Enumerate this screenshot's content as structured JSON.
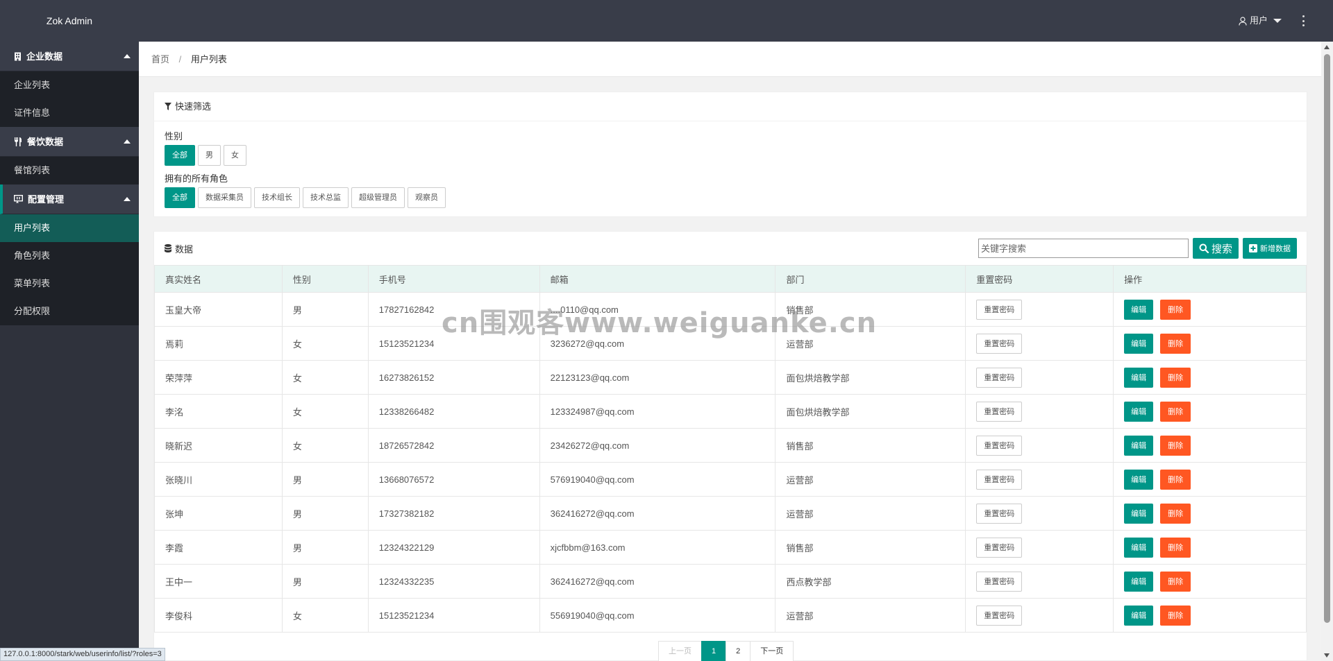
{
  "app": {
    "title": "Zok Admin"
  },
  "header": {
    "user_label": "用户"
  },
  "sidebar": {
    "groups": [
      {
        "title": "企业数据",
        "icon": "building-icon",
        "items": [
          "企业列表",
          "证件信息"
        ]
      },
      {
        "title": "餐饮数据",
        "icon": "utensils-icon",
        "items": [
          "餐馆列表"
        ]
      },
      {
        "title": "配置管理",
        "icon": "monitor-icon",
        "items": [
          "用户列表",
          "角色列表",
          "菜单列表",
          "分配权限"
        ]
      }
    ],
    "active_item": "用户列表"
  },
  "breadcrumb": {
    "home": "首页",
    "separator": "/",
    "current": "用户列表"
  },
  "filter": {
    "title": "快速筛选",
    "gender_label": "性别",
    "gender_options": [
      "全部",
      "男",
      "女"
    ],
    "gender_selected": "全部",
    "roles_label": "拥有的所有角色",
    "role_options": [
      "全部",
      "数据采集员",
      "技术组长",
      "技术总监",
      "超级管理员",
      "观察员"
    ],
    "role_selected": "全部"
  },
  "data_panel": {
    "title": "数据",
    "search_placeholder": "关键字搜索",
    "search_button": "搜索",
    "add_button": "新增数据"
  },
  "table": {
    "columns": [
      "真实姓名",
      "性别",
      "手机号",
      "邮箱",
      "部门",
      "重置密码",
      "操作"
    ],
    "reset_label": "重置密码",
    "edit_label": "编辑",
    "delete_label": "删除",
    "rows": [
      [
        "玉皇大帝",
        "男",
        "17827162842",
        "....0110@qq.com",
        "销售部"
      ],
      [
        "焉莉",
        "女",
        "15123521234",
        "3236272@qq.com",
        "运营部"
      ],
      [
        "荣萍萍",
        "女",
        "16273826152",
        "22123123@qq.com",
        "面包烘焙教学部"
      ],
      [
        "李洺",
        "女",
        "12338266482",
        "123324987@qq.com",
        "面包烘焙教学部"
      ],
      [
        "晓新迟",
        "女",
        "18726572842",
        "23426272@qq.com",
        "销售部"
      ],
      [
        "张晓川",
        "男",
        "13668076572",
        "576919040@qq.com",
        "运营部"
      ],
      [
        "张坤",
        "男",
        "17327382182",
        "362416272@qq.com",
        "运营部"
      ],
      [
        "李霞",
        "男",
        "12324322129",
        "xjcfbbm@163.com",
        "销售部"
      ],
      [
        "王中一",
        "男",
        "12324332235",
        "362416272@qq.com",
        "西点教学部"
      ],
      [
        "李俊科",
        "女",
        "15123521234",
        "556919040@qq.com",
        "运营部"
      ]
    ]
  },
  "pagination": {
    "prev": "上一页",
    "pages": [
      "1",
      "2"
    ],
    "current": "1",
    "next": "下一页"
  },
  "status_bar": {
    "url": "127.0.0.1:8000/stark/web/userinfo/list/?roles=3"
  },
  "watermark": {
    "text": "cn围观客www.weiguanke.cn"
  },
  "colors": {
    "header": "#393d49",
    "sidebar": "#2f323c",
    "accent": "#009688",
    "danger": "#ff5722",
    "active_menu": "#135d57"
  }
}
